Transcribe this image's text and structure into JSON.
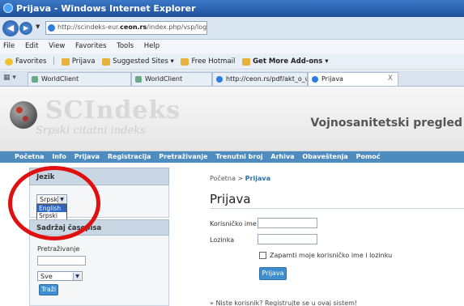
{
  "window": {
    "title": "Prijava - Windows Internet Explorer"
  },
  "address": {
    "url_prefix": "http://scindeks-eur.",
    "url_domain": "ceon.rs",
    "url_suffix": "/index.php/vsp/login"
  },
  "menubar": [
    "File",
    "Edit",
    "View",
    "Favorites",
    "Tools",
    "Help"
  ],
  "favorites": {
    "label": "Favorites",
    "items": [
      "Prijava",
      "Suggested Sites ▾",
      "Free Hotmail",
      "Get More Add-ons ▾"
    ]
  },
  "tabs": [
    {
      "label": "WorldClient"
    },
    {
      "label": "WorldClient"
    },
    {
      "label": "http://ceon.rs/pdf/akt_o_ur..."
    },
    {
      "label": "Prijava",
      "close": "X"
    }
  ],
  "banner": {
    "logo_title": "SCIndeks",
    "logo_subtitle": "Srpski citatni indeks",
    "journal": "Vojnosanitetski pregled"
  },
  "mainnav": [
    "Početna",
    "Info",
    "Prijava",
    "Registracija",
    "Pretraživanje",
    "Trenutni broj",
    "Arhiva",
    "Obaveštenja",
    "Pomoć"
  ],
  "sidebar": {
    "language": {
      "heading": "Jezik",
      "selected": "Srpski",
      "options": [
        "English",
        "Srpski"
      ]
    },
    "contents": {
      "heading": "Sadržaj časopisa",
      "search_label": "Pretraživanje",
      "scope_selected": "Sve",
      "search_button": "Traži"
    }
  },
  "main": {
    "breadcrumb_home": "Početna",
    "breadcrumb_sep": ">",
    "breadcrumb_current": "Prijava",
    "title": "Prijava",
    "username_label": "Korisničko ime",
    "password_label": "Lozinka",
    "remember_label": "Zapamti moje korisničko ime i lozinku",
    "login_button": "Prijava",
    "register_text": "» Niste korisnik? Registrujte se u ovaj sistem!"
  },
  "colors": {
    "nav": "#4e8cc0",
    "button": "#3f8fd0",
    "highlight": "#2f64c5",
    "annotation": "#e01010"
  }
}
